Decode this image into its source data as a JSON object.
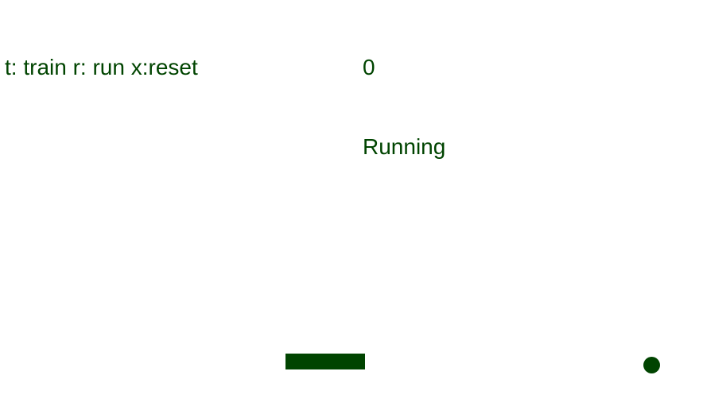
{
  "hud": {
    "controls_hint": "t: train r: run x:reset",
    "score": "0",
    "status": "Running"
  },
  "game": {
    "color": "#004400",
    "background": "#ffffff"
  }
}
